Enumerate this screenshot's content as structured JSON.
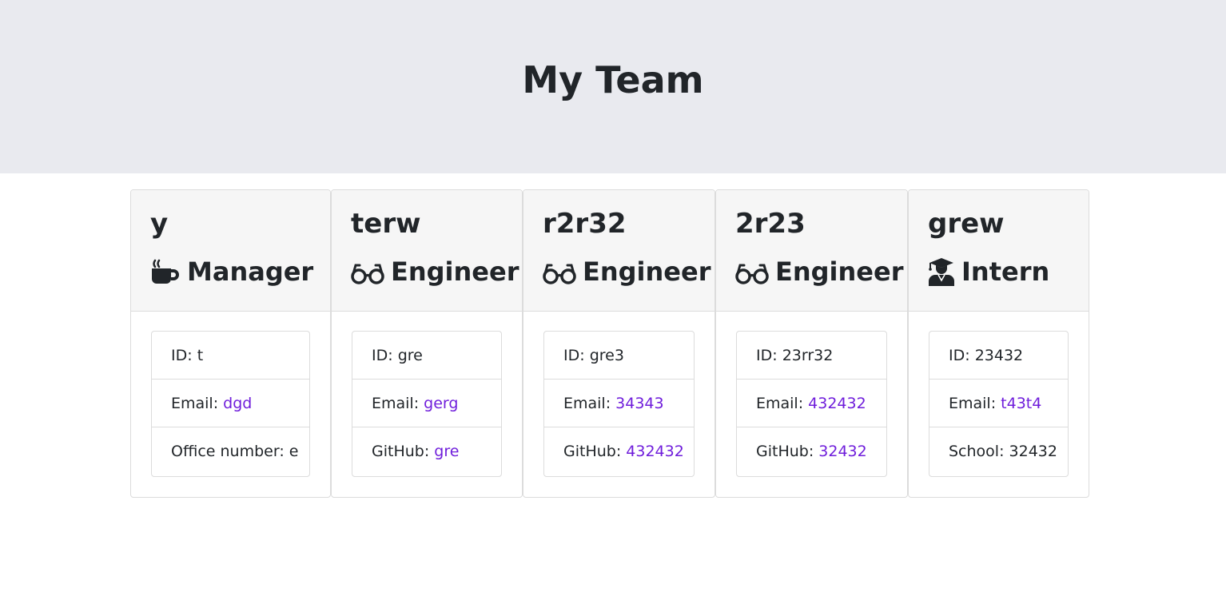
{
  "header": {
    "title": "My Team"
  },
  "employees": [
    {
      "name": "y",
      "role": "Manager",
      "role_icon": "coffee-mug-icon",
      "id_label": "ID: ",
      "id": "t",
      "email_label": "Email: ",
      "email": "dgd",
      "extra_label": "Office number: ",
      "extra": "e"
    },
    {
      "name": "terw",
      "role": "Engineer",
      "role_icon": "glasses-icon",
      "id_label": "ID: ",
      "id": "gre",
      "email_label": "Email: ",
      "email": "gerg",
      "extra_label": "GitHub: ",
      "extra": "gre"
    },
    {
      "name": "r2r32",
      "role": "Engineer",
      "role_icon": "glasses-icon",
      "id_label": "ID: ",
      "id": "gre3",
      "email_label": "Email: ",
      "email": "34343",
      "extra_label": "GitHub: ",
      "extra": "432432"
    },
    {
      "name": "2r23",
      "role": "Engineer",
      "role_icon": "glasses-icon",
      "id_label": "ID: ",
      "id": "23rr32",
      "email_label": "Email: ",
      "email": "432432",
      "extra_label": "GitHub: ",
      "extra": "32432"
    },
    {
      "name": "grew",
      "role": "Intern",
      "role_icon": "graduate-icon",
      "id_label": "ID: ",
      "id": "23432",
      "email_label": "Email: ",
      "email": "t43t4",
      "extra_label": "School: ",
      "extra": "32432"
    }
  ],
  "colors": {
    "link": "#6f1ddb",
    "header_bg": "#e9eaef",
    "card_header_bg": "#f6f6f6"
  }
}
